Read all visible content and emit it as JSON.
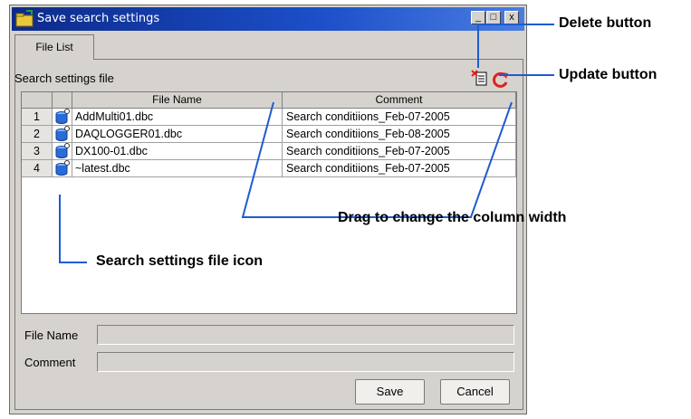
{
  "window": {
    "title": "Save search settings",
    "controls": [
      "_",
      "□",
      "x"
    ]
  },
  "tabs": [
    {
      "label": "File List"
    }
  ],
  "section_label": "Search settings file",
  "table": {
    "columns": [
      "File Name",
      "Comment"
    ],
    "rows": [
      {
        "num": "1",
        "file": "AddMulti01.dbc",
        "comment": "Search conditiions_Feb-07-2005"
      },
      {
        "num": "2",
        "file": "DAQLOGGER01.dbc",
        "comment": "Search conditiions_Feb-08-2005"
      },
      {
        "num": "3",
        "file": "DX100-01.dbc",
        "comment": "Search conditiions_Feb-07-2005"
      },
      {
        "num": "4",
        "file": "~latest.dbc",
        "comment": "Search conditiions_Feb-07-2005"
      }
    ]
  },
  "form": {
    "file_name_label": "File Name",
    "file_name_value": "",
    "comment_label": "Comment",
    "comment_value": ""
  },
  "buttons": {
    "save": "Save",
    "cancel": "Cancel"
  },
  "callouts": {
    "delete": "Delete button",
    "update": "Update button",
    "drag": "Drag to change the column width",
    "icon": "Search settings file icon"
  },
  "icons": {
    "delete": "delete-icon",
    "update": "refresh-icon",
    "file": "database-file-icon"
  },
  "colors": {
    "titlebar": "#1c4fc9",
    "accent_blue": "#2a6bd6",
    "delete_red": "#e02020",
    "update_red": "#e02020"
  }
}
